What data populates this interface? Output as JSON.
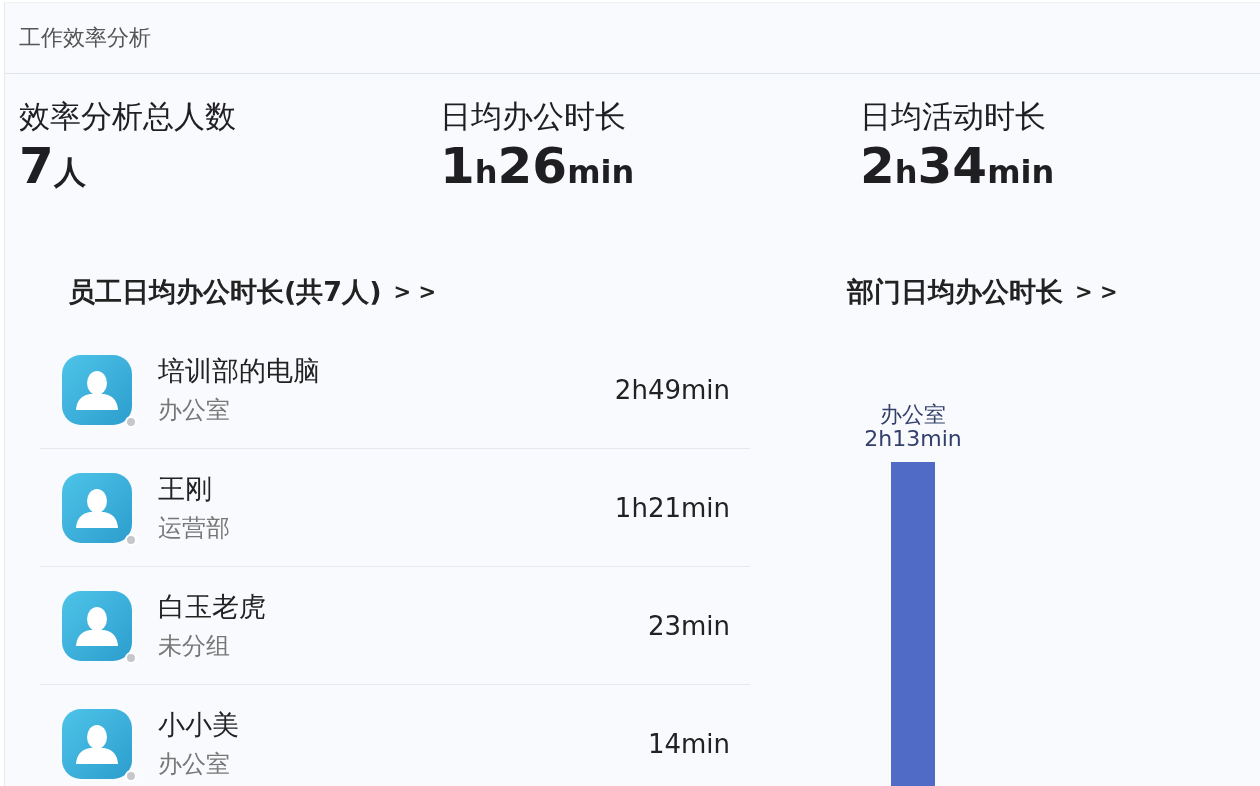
{
  "panel": {
    "title": "工作效率分析"
  },
  "stats": [
    {
      "label": "效率分析总人数",
      "value": "7人"
    },
    {
      "label": "日均办公时长",
      "value": "1h26min"
    },
    {
      "label": "日均活动时长",
      "value": "2h34min"
    }
  ],
  "employees": {
    "title": "员工日均办公时长(共7人)",
    "more": "> >",
    "rows": [
      {
        "name": "培训部的电脑",
        "department": "办公室",
        "time": "2h49min",
        "online": false
      },
      {
        "name": "王刚",
        "department": "运营部",
        "time": "1h21min",
        "online": false
      },
      {
        "name": "白玉老虎",
        "department": "未分组",
        "time": "23min",
        "online": false
      },
      {
        "name": "小小美",
        "department": "办公室",
        "time": "14min",
        "online": false
      }
    ]
  },
  "departments": {
    "title": "部门日均办公时长",
    "more": "> >",
    "bars": [
      {
        "department": "办公室",
        "time": "2h13min"
      }
    ]
  }
}
